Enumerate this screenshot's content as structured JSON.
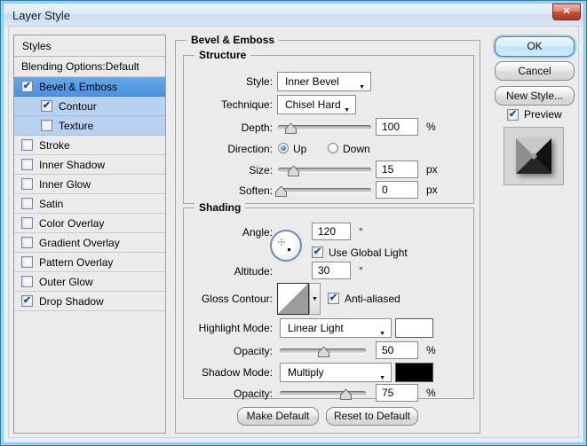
{
  "window": {
    "title": "Layer Style",
    "close_glyph": "✕"
  },
  "sidebar": {
    "header": "Styles",
    "items": [
      {
        "label": "Blending Options:Default",
        "check": null
      },
      {
        "label": "Bevel & Emboss",
        "check": "✔"
      },
      {
        "label": "Contour",
        "check": "✔"
      },
      {
        "label": "Texture",
        "check": ""
      },
      {
        "label": "Stroke",
        "check": ""
      },
      {
        "label": "Inner Shadow",
        "check": ""
      },
      {
        "label": "Inner Glow",
        "check": ""
      },
      {
        "label": "Satin",
        "check": ""
      },
      {
        "label": "Color Overlay",
        "check": ""
      },
      {
        "label": "Gradient Overlay",
        "check": ""
      },
      {
        "label": "Pattern Overlay",
        "check": ""
      },
      {
        "label": "Outer Glow",
        "check": ""
      },
      {
        "label": "Drop Shadow",
        "check": "✔"
      }
    ]
  },
  "panel": {
    "title": "Bevel & Emboss",
    "structure": {
      "title": "Structure",
      "style_label": "Style:",
      "style_value": "Inner Bevel",
      "technique_label": "Technique:",
      "technique_value": "Chisel Hard",
      "depth_label": "Depth:",
      "depth_value": "100",
      "depth_unit": "%",
      "depth_pct": 13,
      "direction_label": "Direction:",
      "up_label": "Up",
      "down_label": "Down",
      "direction_selected": "Up",
      "size_label": "Size:",
      "size_value": "15",
      "size_unit": "px",
      "size_pct": 16,
      "soften_label": "Soften:",
      "soften_value": "0",
      "soften_unit": "px",
      "soften_pct": 3
    },
    "shading": {
      "title": "Shading",
      "angle_label": "Angle:",
      "angle_value": "120",
      "angle_unit": "°",
      "use_global_light_label": "Use Global Light",
      "use_global_light_check": "✔",
      "altitude_label": "Altitude:",
      "altitude_value": "30",
      "altitude_unit": "°",
      "gloss_label": "Gloss Contour:",
      "anti_aliased_label": "Anti-aliased",
      "anti_aliased_check": "✔",
      "highlight_label": "Highlight Mode:",
      "highlight_value": "Linear Light",
      "highlight_color": "#ffffff",
      "highlight_opacity_label": "Opacity:",
      "highlight_opacity_value": "50",
      "highlight_opacity_unit": "%",
      "highlight_opacity_pct": 50,
      "shadow_label": "Shadow Mode:",
      "shadow_value": "Multiply",
      "shadow_color": "#000000",
      "shadow_opacity_label": "Opacity:",
      "shadow_opacity_value": "75",
      "shadow_opacity_unit": "%",
      "shadow_opacity_pct": 76
    },
    "footer": {
      "make_default": "Make Default",
      "reset_default": "Reset to Default"
    }
  },
  "actions": {
    "ok": "OK",
    "cancel": "Cancel",
    "new_style": "New Style...",
    "preview_label": "Preview",
    "preview_check": "✔"
  },
  "colors": {
    "selection_blue": "#4f97e0",
    "sub_selection_blue": "#b7d1ee",
    "titlebar_blue": "#d9e7f5",
    "close_red": "#c4503a"
  }
}
